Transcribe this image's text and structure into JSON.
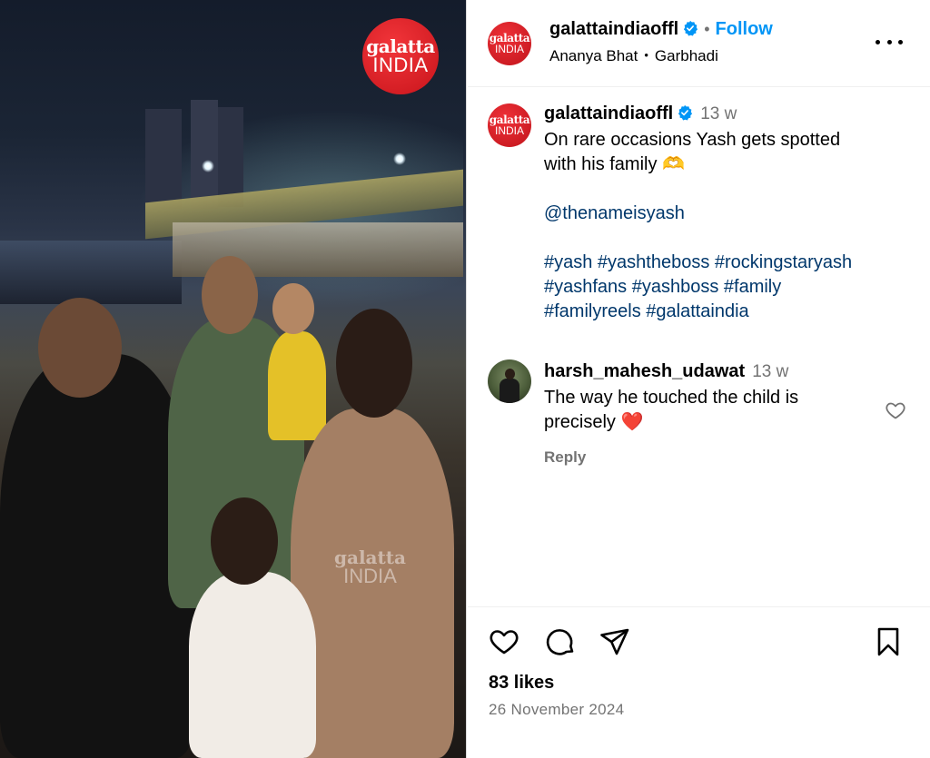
{
  "media": {
    "logo_line1": "galatta",
    "logo_line2": "INDIA",
    "watermark_line1": "galatta",
    "watermark_line2": "INDIA"
  },
  "header": {
    "avatar_line1": "galatta",
    "avatar_line2": "INDIA",
    "username": "galattaindiaoffl",
    "separator": "•",
    "follow_label": "Follow",
    "collaborator": "Ananya Bhat",
    "location": "Garbhadi",
    "more_icon": "more-horizontal-icon"
  },
  "caption": {
    "avatar_line1": "galatta",
    "avatar_line2": "INDIA",
    "username": "galattaindiaoffl",
    "time": "13 w",
    "text_line1": "On rare occasions Yash gets spotted",
    "text_line2": "with his family 🫶",
    "mention": "@thenameisyash",
    "tags_line1": "#yash #yashtheboss #rockingstaryash",
    "tags_line2": "#yashfans #yashboss #family",
    "tags_line3": "#familyreels #galattaindia"
  },
  "comment": {
    "username": "harsh_mahesh_udawat",
    "time": "13 w",
    "text_line1": "The way he touched the child is",
    "text_line2": "precisely ❤️",
    "reply_label": "Reply"
  },
  "actions": {
    "likes": "83 likes",
    "date": "26 November 2024"
  },
  "colors": {
    "brand_red": "#d81e25",
    "link_blue": "#0095f6",
    "hashtag_blue": "#00376b",
    "muted_gray": "#737373",
    "verified_blue": "#0095f6"
  }
}
